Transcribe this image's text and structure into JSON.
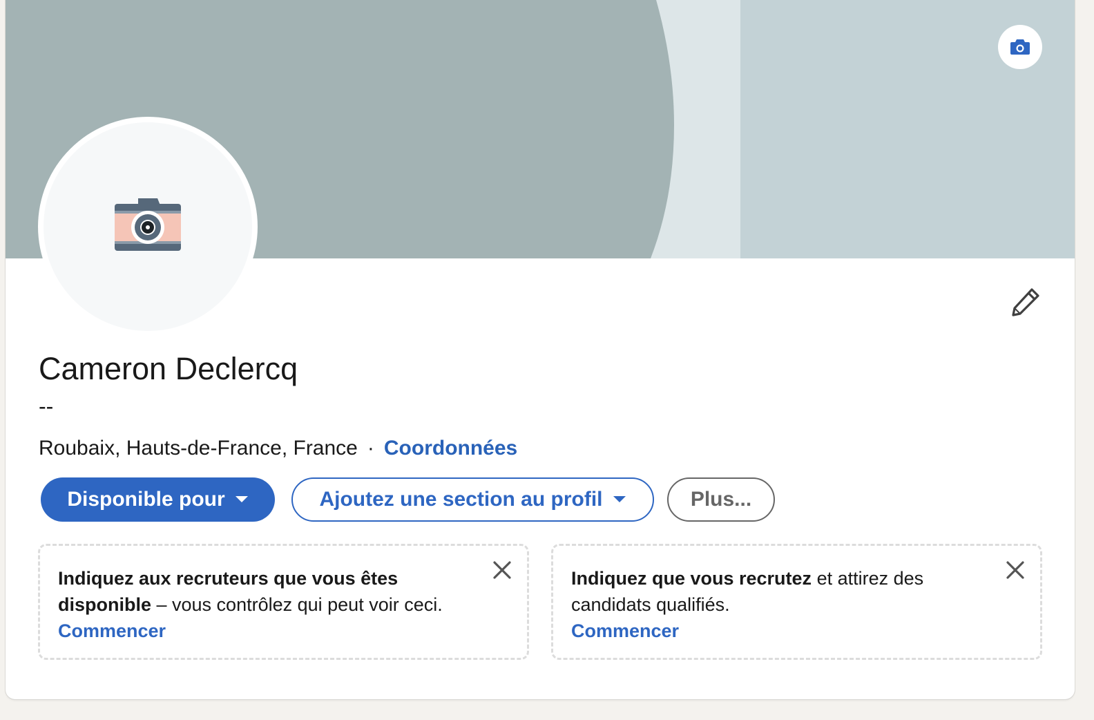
{
  "profile": {
    "name": "Cameron Declercq",
    "headline": "--",
    "location": "Roubaix, Hauts-de-France, France",
    "separator": "·",
    "contact_link": "Coordonnées"
  },
  "actions": {
    "open_to_label": "Disponible pour",
    "add_section_label": "Ajoutez une section au profil",
    "more_label": "Plus..."
  },
  "promos": [
    {
      "bold_text": "Indiquez aux recruteurs que vous êtes disponible",
      "text": " – vous contrôlez qui peut voir ceci.",
      "link": "Commencer"
    },
    {
      "bold_text": "Indiquez que vous recrutez",
      "text": " et attirez des candidats qualifiés.",
      "link": "Commencer"
    }
  ],
  "icons": {
    "banner_camera": "camera-icon",
    "avatar_placeholder": "camera-illustration-icon",
    "edit": "pencil-icon",
    "caret": "caret-down-icon",
    "dismiss": "close-icon"
  },
  "colors": {
    "brand_blue": "#2e66c2",
    "banner_dark": "#a3b3b4",
    "banner_mid": "#dde6e8",
    "banner_light": "#c3d2d6"
  }
}
